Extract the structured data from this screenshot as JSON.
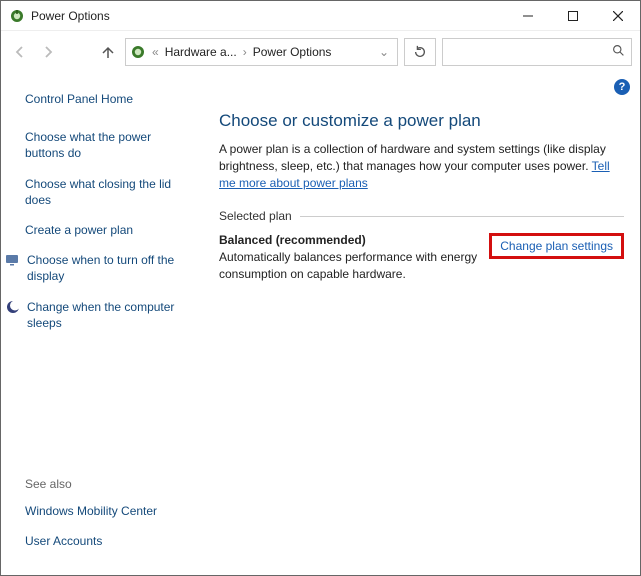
{
  "window": {
    "title": "Power Options"
  },
  "breadcrumbs": {
    "prefix": "«",
    "crumb1": "Hardware a...",
    "crumb2": "Power Options"
  },
  "search": {
    "placeholder": ""
  },
  "sidebar": {
    "home": "Control Panel Home",
    "items": [
      "Choose what the power buttons do",
      "Choose what closing the lid does",
      "Create a power plan",
      "Choose when to turn off the display",
      "Change when the computer sleeps"
    ],
    "seealso_label": "See also",
    "seealso": [
      "Windows Mobility Center",
      "User Accounts"
    ]
  },
  "main": {
    "heading": "Choose or customize a power plan",
    "desc_before": "A power plan is a collection of hardware and system settings (like display brightness, sleep, etc.) that manages how your computer uses power. ",
    "desc_link": "Tell me more about power plans",
    "section_label": "Selected plan",
    "plan": {
      "title": "Balanced (recommended)",
      "desc": "Automatically balances performance with energy consumption on capable hardware.",
      "change_link": "Change plan settings"
    }
  },
  "help_glyph": "?"
}
